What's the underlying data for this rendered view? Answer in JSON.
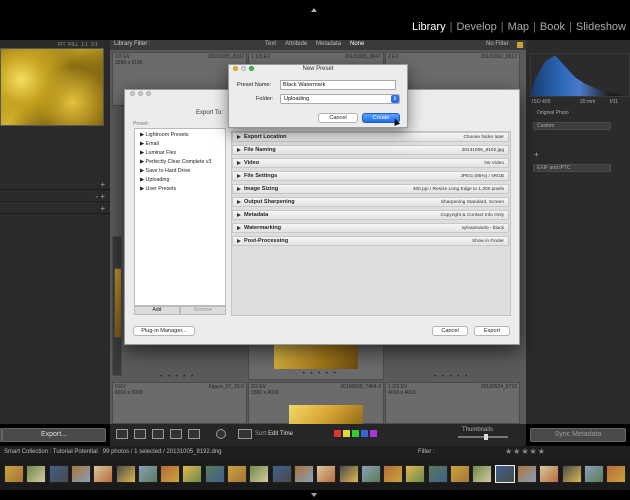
{
  "modules": {
    "items": [
      "Library",
      "Develop",
      "Map",
      "Book",
      "Slideshow"
    ],
    "active": "Library",
    "separator": "|"
  },
  "library_filter": {
    "label": "Library Filter :",
    "options": [
      "Text",
      "Attribute",
      "Metadata",
      "None"
    ],
    "preset": "No Filter"
  },
  "grid": {
    "top_row": [
      {
        "ev": "2/3 EV",
        "file": "20131005_8192",
        "dims": "3390 x 3186"
      },
      {
        "ev": "1 1/3 EV",
        "file": "",
        "dims": ""
      },
      {
        "ev": "",
        "file": "20131005_8047",
        "dims": ""
      },
      {
        "ev": "2 EV",
        "file": "20131002_8813",
        "dims": ""
      }
    ],
    "bottom_row": [
      {
        "ev": "0 EV",
        "file": "Figure_07_23-2",
        "dims": "6016 x 3000"
      },
      {
        "ev": "2/3 EV",
        "file": "20130928_7464-2",
        "dims": "3381 x 4016"
      },
      {
        "ev": "1 2/3 EV",
        "file": "20130924_6710",
        "dims": "4016 x 4016"
      }
    ],
    "dots": "• • • • •"
  },
  "export_dialog": {
    "title": "Export To:",
    "preset_header": "Preset:",
    "presets": [
      "Lightroom Presets",
      "Email",
      "Luminar Flex",
      "Perfectly Clear Complete v3",
      "Save to Hard Drive",
      "Uploading",
      "User Presets"
    ],
    "add_label": "Add",
    "remove_label": "Remove",
    "sections": [
      {
        "label": "Export Location",
        "value": "Choose folder later"
      },
      {
        "label": "File Naming",
        "value": "20131005_8192.jpg"
      },
      {
        "label": "Video",
        "value": "No Video"
      },
      {
        "label": "File Settings",
        "value": "JPEG (85%) / sRGB"
      },
      {
        "label": "Image Sizing",
        "value": "300 ppi / Resize Long Edge to 1,200 pixels"
      },
      {
        "label": "Output Sharpening",
        "value": "Sharpening Standard, Screen"
      },
      {
        "label": "Metadata",
        "value": "Copyright & Contact Info Only"
      },
      {
        "label": "Watermarking",
        "value": "sylvainsvielo - black"
      },
      {
        "label": "Post-Processing",
        "value": "Show in Finder"
      }
    ],
    "plugin_manager_label": "Plug-in Manager...",
    "cancel_label": "Cancel",
    "export_label": "Export"
  },
  "new_preset": {
    "title": "New Preset",
    "name_label": "Preset Name:",
    "name_value": "Black Watermark",
    "folder_label": "Folder:",
    "folder_value": "Uploading",
    "cancel_label": "Cancel",
    "create_label": "Create"
  },
  "left_panel": {
    "export_button": "Export...",
    "nav_labels": [
      "FIT",
      "FILL",
      "1:1",
      "3:1"
    ]
  },
  "right_panel": {
    "histogram_readout": [
      "ISO 400",
      "20 mm",
      "f/11"
    ],
    "original_photo": "Original Photo",
    "custom_label": "Custom",
    "exif_label": "EXIF and IPTC",
    "sync_button": "Sync Metadata"
  },
  "toolbar": {
    "sort_label": "Sort:",
    "sort_value": "Edit Time",
    "thumbnails_label": "Thumbnails",
    "chip_colors": [
      "#d33",
      "#dd3",
      "#3c3",
      "#36d",
      "#a3d"
    ]
  },
  "filmstrip": {
    "path": "Smart Collection : Tutorial Potential",
    "count": "99 photos / 1 selected / 20131005_8192.dng",
    "filter_label": "Filter :",
    "stars": "★★★★★"
  },
  "colors": {
    "accent_blue": "#2d6ff0",
    "panel_bg": "#2b2b2b"
  }
}
